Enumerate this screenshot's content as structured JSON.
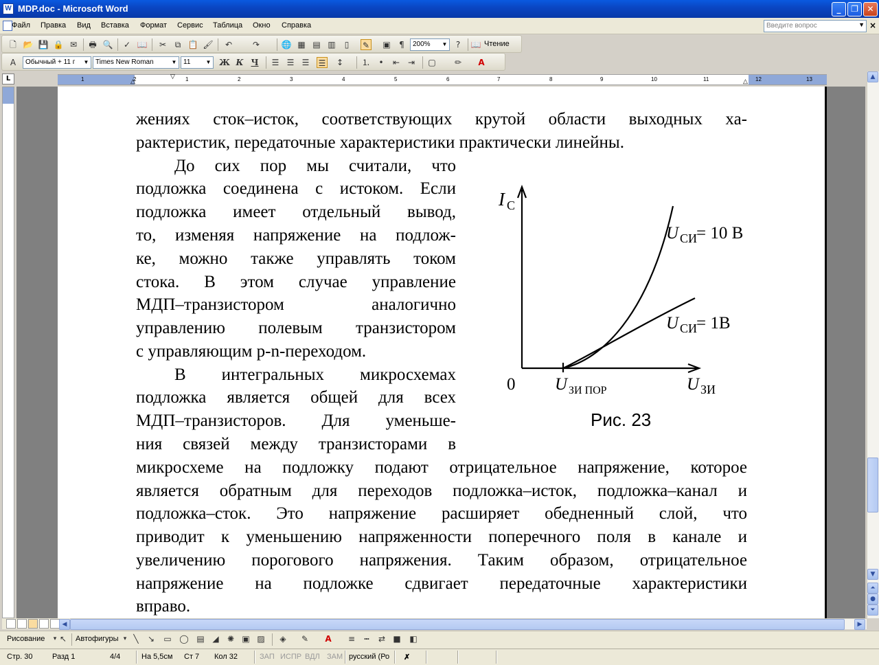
{
  "window": {
    "title": "MDP.doc - Microsoft Word",
    "icon": "word-doc-icon"
  },
  "menu": {
    "items": [
      "Файл",
      "Правка",
      "Вид",
      "Вставка",
      "Формат",
      "Сервис",
      "Таблица",
      "Окно",
      "Справка"
    ],
    "ask_placeholder": "Введите вопрос"
  },
  "toolbar_standard": {
    "zoom": "200%",
    "reading_label": "Чтение"
  },
  "toolbar_format": {
    "style": "Обычный + 11 г",
    "font": "Times New Roman",
    "size": "11",
    "bold": "Ж",
    "italic": "К",
    "underline": "Ч"
  },
  "ruler": {
    "numbers": [
      "1",
      "2",
      "1",
      "2",
      "3",
      "4",
      "5",
      "6",
      "7",
      "8",
      "9",
      "10",
      "11",
      "12",
      "13"
    ]
  },
  "document": {
    "top_lines": [
      "жениях сток–исток, соответствующих крутой области выходных ха-",
      "рактеристик, передаточные характеристики практически линейны."
    ],
    "para2_lines": [
      "До сих пор мы считали, что",
      "подложка соединена с истоком. Если",
      "подложка имеет отдельный вывод,",
      "то, изменяя напряжение на подлож-",
      "ке, можно также управлять током",
      "стока. В этом случае управление",
      "МДП–транзистором аналогично",
      "управлению полевым транзистором",
      "с управляющим p-n-переходом."
    ],
    "para3_lines": [
      "В интегральных микросхемах",
      "подложка является общей для всех",
      "МДП–транзисторов. Для уменьше-",
      "ния связей между транзисторами в",
      "микросхеме на подложку подают отрицательное напряжение, которое",
      "является обратным для переходов подложка–исток, подложка–канал и",
      "подложка–сток. Это напряжение расширяет обедненный слой, что",
      "приводит к уменьшению напряженности поперечного поля в канале и",
      "увеличению порогового напряжения. Таким образом, отрицательное",
      "напряжение на подложке сдвигает передаточные характеристики",
      "вправо."
    ],
    "figure": {
      "caption": "Рис. 23",
      "y_axis_label": "I",
      "y_axis_sub": "С",
      "x_axis_label": "U",
      "x_axis_sub": "ЗИ",
      "origin": "0",
      "threshold_label": "U",
      "threshold_sub": "ЗИ ПОР",
      "curve1_label": "U",
      "curve1_sub": "СИ",
      "curve1_value": " = 10 В",
      "curve2_label": "U",
      "curve2_sub": "СИ",
      "curve2_value": " = 1В"
    }
  },
  "drawing_toolbar": {
    "drawing": "Рисование",
    "autoshapes": "Автофигуры"
  },
  "statusbar": {
    "page": "Стр. 30",
    "section": "Разд 1",
    "pages": "4/4",
    "at": "На 5,5см",
    "line": "Ст 7",
    "col": "Кол 32",
    "rec": "ЗАП",
    "trk": "ИСПР",
    "ext": "ВДЛ",
    "ovr": "ЗАМ",
    "lang": "русский (Ро"
  }
}
